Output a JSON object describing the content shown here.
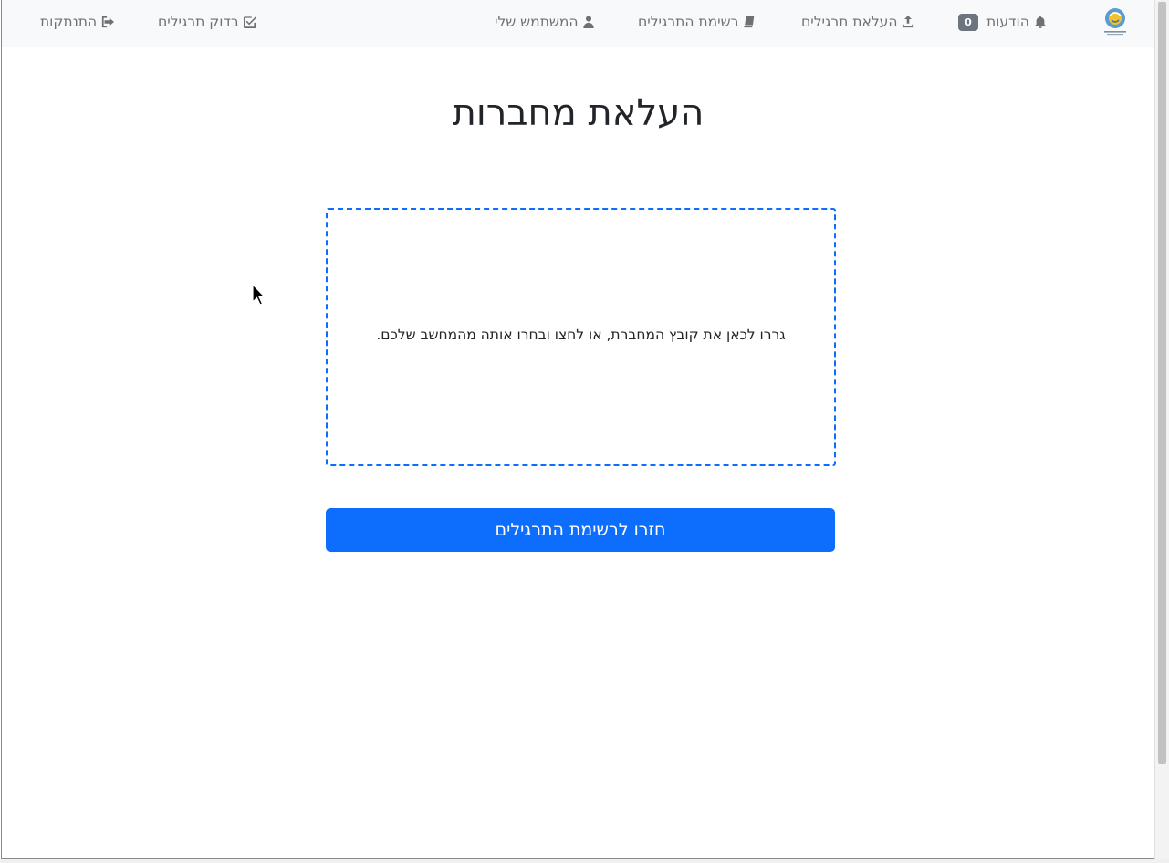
{
  "navbar": {
    "logo_icon": "school-logo-icon",
    "notifications": {
      "label": "הודעות",
      "count": "0",
      "icon": "bell-icon"
    },
    "upload_exercises": {
      "label": "העלאת תרגילים",
      "icon": "upload-icon"
    },
    "exercise_list": {
      "label": "רשימת התרגילים",
      "icon": "book-icon"
    },
    "my_user": {
      "label": "המשתמש שלי",
      "icon": "user-icon"
    },
    "check_exercises": {
      "label": "בדוק תרגילים",
      "icon": "check-square-icon"
    },
    "logout": {
      "label": "התנתקות",
      "icon": "sign-out-icon"
    }
  },
  "main": {
    "title": "העלאת מחברות",
    "dropzone": {
      "text": "גררו לכאן את קובץ המחברת, או לחצו ובחרו אותה מהמחשב שלכם."
    },
    "back_button_label": "חזרו לרשימת התרגילים"
  },
  "colors": {
    "primary": "#0d6efd",
    "navbar_bg": "#f8f9fa",
    "badge_bg": "#6c757d",
    "text": "#212529"
  }
}
